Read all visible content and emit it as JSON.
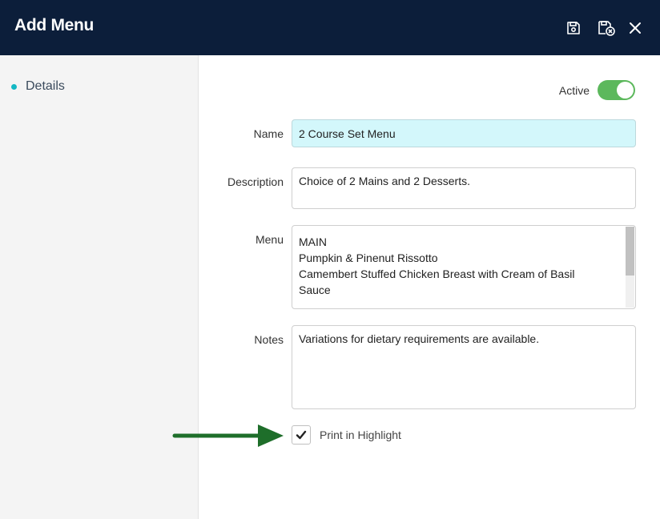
{
  "header": {
    "title": "Add Menu",
    "icons": [
      "save-icon",
      "save-close-icon",
      "close-icon"
    ]
  },
  "sidebar": {
    "items": [
      {
        "label": "Details"
      }
    ]
  },
  "form": {
    "active_label": "Active",
    "active": true,
    "name_label": "Name",
    "name_value": "2 Course Set Menu",
    "description_label": "Description",
    "description_value": "Choice of 2 Mains and 2 Desserts.",
    "menu_label": "Menu",
    "menu_lines": [
      "MAIN",
      "Pumpkin & Pinenut Rissotto",
      "Camembert Stuffed Chicken Breast with Cream of Basil",
      "Sauce"
    ],
    "notes_label": "Notes",
    "notes_value": "Variations for dietary requirements are available.",
    "print_label": "Print in Highlight",
    "print_checked": true
  },
  "colors": {
    "header_bg": "#0c1e3a",
    "accent_dot": "#14b8c4",
    "toggle_on": "#5cb85c",
    "name_field_bg": "#d3f7fb",
    "arrow": "#1e6e2a"
  }
}
